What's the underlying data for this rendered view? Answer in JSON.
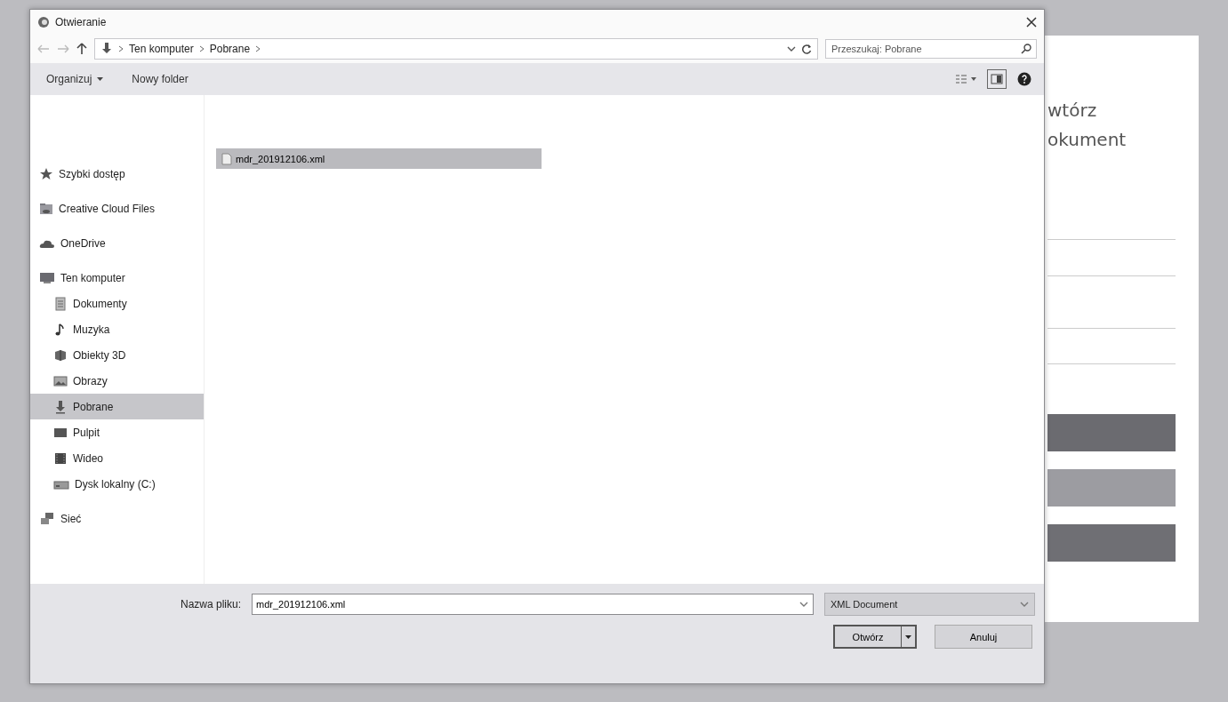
{
  "window": {
    "title": "Otwieranie"
  },
  "address": {
    "path": [
      "Ten komputer",
      "Pobrane"
    ]
  },
  "search": {
    "placeholder": "Przeszukaj: Pobrane"
  },
  "toolbar": {
    "items": [
      {
        "label": "Organizuj",
        "kind": "menu"
      },
      {
        "label": "Nowy folder",
        "kind": "button"
      }
    ]
  },
  "sidebar": {
    "items": [
      {
        "label": "Szybki dostęp",
        "kind": "star",
        "selected": false
      },
      {
        "label": "Creative Cloud Files",
        "kind": "cloud-folder",
        "selected": false
      },
      {
        "label": "OneDrive",
        "kind": "cloud",
        "selected": false
      },
      {
        "label": "Ten komputer",
        "kind": "computer",
        "selected": false,
        "children": [
          {
            "label": "Dokumenty",
            "kind": "document",
            "selected": false
          },
          {
            "label": "Muzyka",
            "kind": "music",
            "selected": false
          },
          {
            "label": "Obiekty 3D",
            "kind": "cube",
            "selected": false
          },
          {
            "label": "Obrazy",
            "kind": "image",
            "selected": false
          },
          {
            "label": "Pobrane",
            "kind": "download",
            "selected": true
          },
          {
            "label": "Pulpit",
            "kind": "desktop",
            "selected": false
          },
          {
            "label": "Wideo",
            "kind": "video",
            "selected": false
          },
          {
            "label": "Dysk lokalny (C:)",
            "kind": "drive",
            "selected": false
          }
        ]
      },
      {
        "label": "Sieć",
        "kind": "network",
        "selected": false
      }
    ]
  },
  "files": [
    {
      "name": "mdr_201912106.xml",
      "selected": true
    }
  ],
  "filename": {
    "label": "Nazwa pliku:",
    "value": "mdr_201912106.xml"
  },
  "filetype": {
    "value": "XML Document"
  },
  "buttons": [
    {
      "label": "Otwórz",
      "kind": "split"
    },
    {
      "label": "Anuluj",
      "kind": "plain"
    }
  ],
  "background_page": {
    "heading": [
      "wtórz",
      "okument"
    ],
    "buttons": [
      {
        "color": "#6b6b70"
      },
      {
        "color": "#9c9ca1"
      },
      {
        "color": "#6f6f74"
      }
    ]
  }
}
